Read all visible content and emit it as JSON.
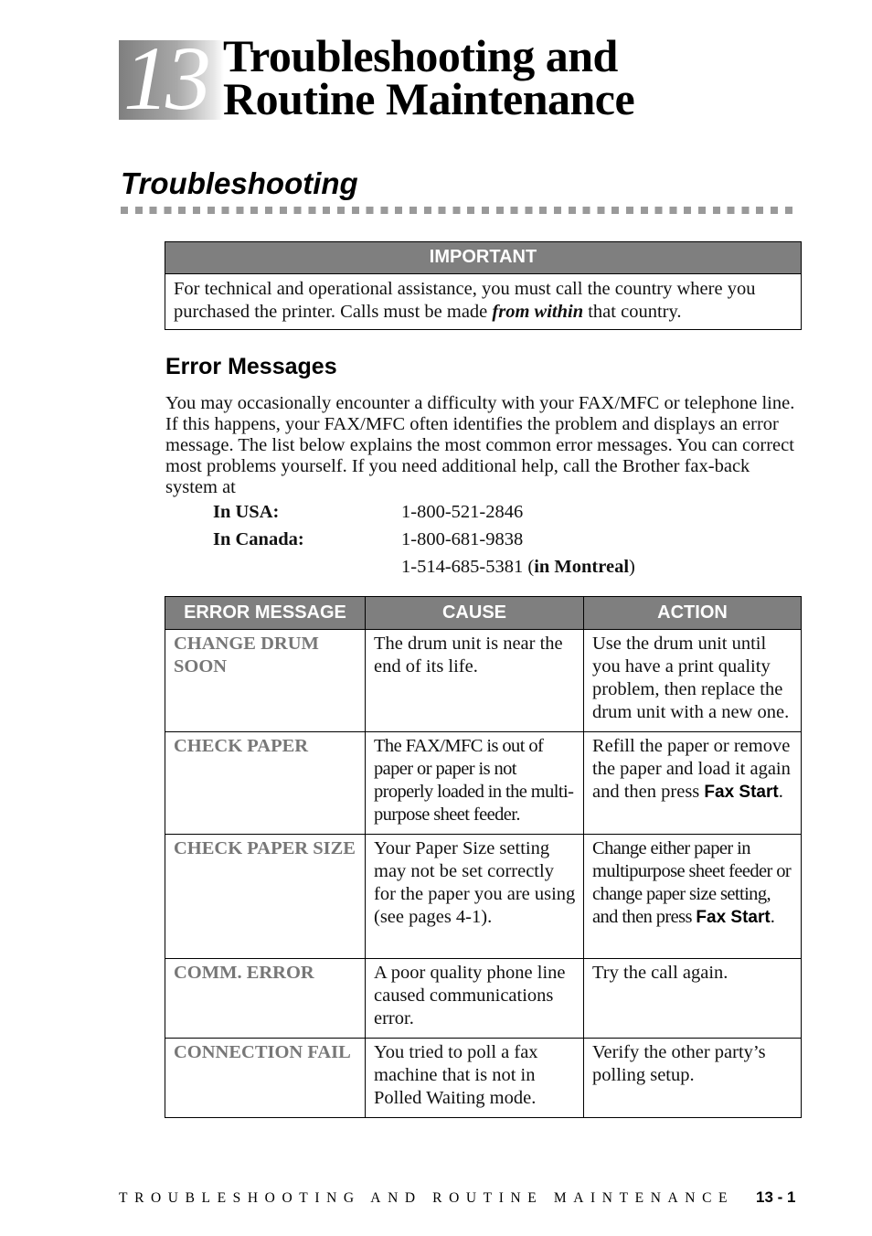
{
  "chapter": {
    "number": "13",
    "title_line1": "Troubleshooting and",
    "title_line2": "Routine Maintenance"
  },
  "section": {
    "title": "Troubleshooting"
  },
  "important": {
    "heading": "IMPORTANT",
    "text_before": "For technical and operational assistance, you must call the country where you purchased the printer. Calls must be made ",
    "emphasis": "from within",
    "text_after": " that country."
  },
  "error_messages": {
    "title": "Error Messages",
    "intro": "You may occasionally encounter a difficulty with your FAX/MFC or telephone line. If this happens, your FAX/MFC often identifies the problem and displays an error message. The list below explains the most common error messages. You can correct most problems yourself. If you need additional help, call the Brother fax-back system at",
    "phones": [
      {
        "label": "In USA:",
        "number": "1-800-521-2846",
        "note": ""
      },
      {
        "label": "In Canada:",
        "number": "1-800-681-9838",
        "note": ""
      },
      {
        "label": "",
        "number": "1-514-685-5381  (",
        "note": "in Montreal",
        "note_close": ")"
      }
    ]
  },
  "table": {
    "headers": [
      "ERROR MESSAGE",
      "CAUSE",
      "ACTION"
    ],
    "rows": [
      {
        "message": "CHANGE DRUM SOON",
        "cause": "The drum unit is near the end of its life.",
        "action": "Use the drum unit until you have a print quality problem, then replace the drum unit with a new one.",
        "action_key": "",
        "action_end": ""
      },
      {
        "message": "CHECK PAPER",
        "cause": "The FAX/MFC is out of paper or paper is not properly loaded in the multi-purpose sheet feeder.",
        "action": "Refill the paper or remove the paper and load it again and then press ",
        "action_key": "Fax Start",
        "action_end": "."
      },
      {
        "message": "CHECK PAPER SIZE",
        "cause": "Your Paper Size setting may not be set correctly for the paper you are using (see pages 4-1).",
        "action": "Change either paper in multipurpose sheet feeder or change paper size setting, and then press ",
        "action_key": "Fax Start",
        "action_end": "."
      },
      {
        "message": "COMM. ERROR",
        "cause": "A poor quality phone line caused communications error.",
        "action": "Try the call again.",
        "action_key": "",
        "action_end": ""
      },
      {
        "message": "CONNECTION FAIL",
        "cause": "You tried to poll a fax machine that is not in Polled Waiting mode.",
        "action": "Verify the other party’s polling setup.",
        "action_key": "",
        "action_end": ""
      }
    ]
  },
  "footer": {
    "title": "TROUBLESHOOTING AND ROUTINE MAINTENANCE",
    "page": "13 - 1"
  }
}
